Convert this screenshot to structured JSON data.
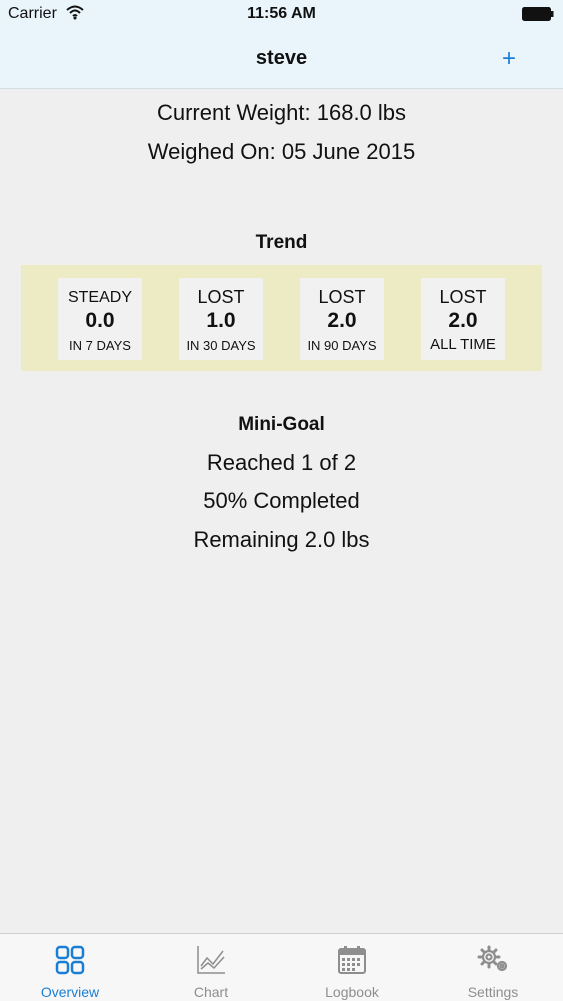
{
  "status_bar": {
    "carrier": "Carrier",
    "time": "11:56 AM"
  },
  "nav": {
    "title": "steve",
    "add_label": "+"
  },
  "summary": {
    "current_weight": "Current Weight: 168.0 lbs",
    "weighed_on": "Weighed On: 05 June 2015"
  },
  "trend": {
    "heading": "Trend",
    "cards": [
      {
        "direction": "STEADY",
        "amount": "0.0",
        "period": "IN 7 DAYS"
      },
      {
        "direction": "LOST",
        "amount": "1.0",
        "period": "IN 30 DAYS"
      },
      {
        "direction": "LOST",
        "amount": "2.0",
        "period": "IN 90 DAYS"
      },
      {
        "direction": "LOST",
        "amount": "2.0",
        "period": "ALL TIME"
      }
    ]
  },
  "mini_goal": {
    "heading": "Mini-Goal",
    "reached": "Reached 1 of 2",
    "completed": "50% Completed",
    "remaining": "Remaining 2.0 lbs"
  },
  "tabs": [
    {
      "label": "Overview",
      "icon": "grid-icon",
      "active": true
    },
    {
      "label": "Chart",
      "icon": "chart-icon",
      "active": false
    },
    {
      "label": "Logbook",
      "icon": "calendar-icon",
      "active": false
    },
    {
      "label": "Settings",
      "icon": "gear-icon",
      "active": false
    }
  ],
  "colors": {
    "accent": "#1a7fd4",
    "nav_background": "#e9f5fb",
    "page_background": "#efefef",
    "trend_panel": "#ecebc3",
    "inactive_tab": "#8e8e8e"
  }
}
